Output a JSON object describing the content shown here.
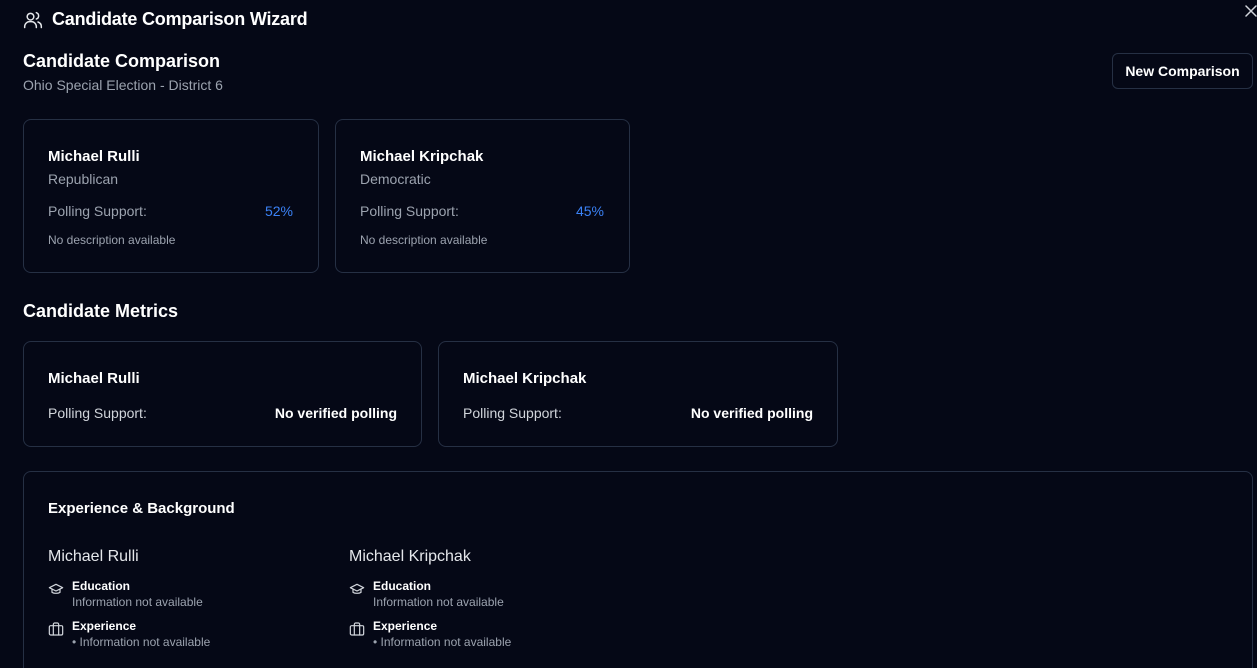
{
  "window": {
    "title": "Candidate Comparison Wizard"
  },
  "header": {
    "title": "Candidate Comparison",
    "subtitle": "Ohio Special Election - District 6",
    "new_button": "New Comparison"
  },
  "candidates": [
    {
      "name": "Michael Rulli",
      "party": "Republican",
      "poll_label": "Polling Support:",
      "poll_value": "52%",
      "description": "No description available"
    },
    {
      "name": "Michael Kripchak",
      "party": "Democratic",
      "poll_label": "Polling Support:",
      "poll_value": "45%",
      "description": "No description available"
    }
  ],
  "metrics": {
    "title": "Candidate Metrics",
    "items": [
      {
        "name": "Michael Rulli",
        "poll_label": "Polling Support:",
        "poll_value": "No verified polling"
      },
      {
        "name": "Michael Kripchak",
        "poll_label": "Polling Support:",
        "poll_value": "No verified polling"
      }
    ]
  },
  "experience": {
    "title": "Experience & Background",
    "columns": [
      {
        "name": "Michael Rulli",
        "education_label": "Education",
        "education_value": "Information not available",
        "experience_label": "Experience",
        "experience_value": "• Information not available"
      },
      {
        "name": "Michael Kripchak",
        "education_label": "Education",
        "education_value": "Information not available",
        "experience_label": "Experience",
        "experience_value": "• Information not available"
      }
    ]
  },
  "colors": {
    "background": "#050816",
    "border": "#263044",
    "accent": "#3b82f6",
    "muted_text": "#9ca3af"
  },
  "icons": {
    "title": "users-icon",
    "close": "close-icon",
    "education": "graduation-cap-icon",
    "experience": "briefcase-icon"
  }
}
